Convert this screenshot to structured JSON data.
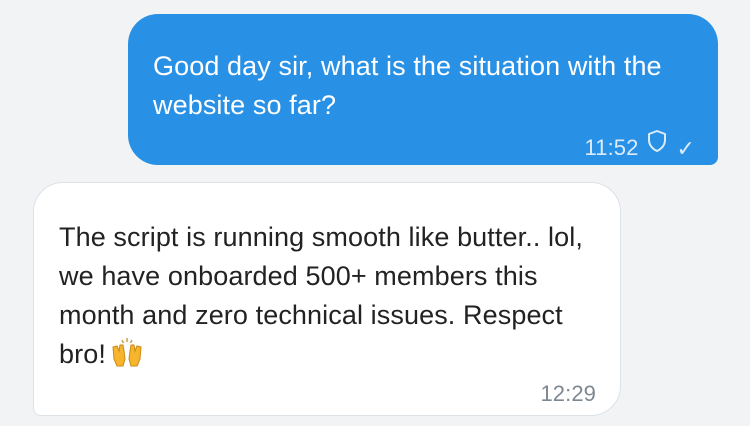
{
  "messages": [
    {
      "direction": "outgoing",
      "text": "Good day sir, what is the situation with the website so far?",
      "time": "11:52",
      "status_icon": "shield-icon",
      "receipt_icon": "checkmark-icon",
      "receipt_glyph": "✓"
    },
    {
      "direction": "incoming",
      "text": "The script is running smooth like butter.. lol, we have onboarded 500+ members this month and zero technical issues. Respect bro!",
      "emoji_icon": "raising-hands-emoji-icon",
      "time": "12:29"
    }
  ],
  "colors": {
    "background": "#f1f3f5",
    "outgoing_bubble": "#2891e6",
    "incoming_bubble": "#ffffff",
    "incoming_border": "#dde2e7",
    "outgoing_meta": "#dcebfa",
    "incoming_meta": "#7e8790",
    "emoji": "#f7b52e"
  }
}
